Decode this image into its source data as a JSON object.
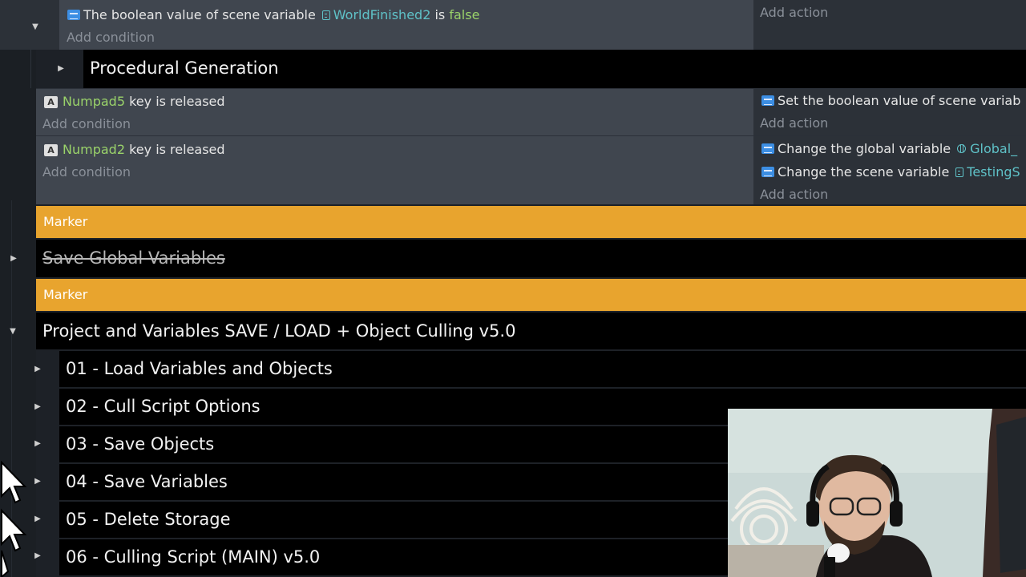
{
  "event_top": {
    "condition_prefix": "The boolean value of scene variable",
    "variable_name": "WorldFinished2",
    "condition_is": "is",
    "condition_value": "false",
    "add_condition": "Add condition",
    "add_action": "Add action"
  },
  "group_procedural": {
    "title": "Procedural Generation"
  },
  "event_numpad5": {
    "key": "Numpad5",
    "condition_text": "key is released",
    "add_condition": "Add condition",
    "action_text": "Set the boolean value of scene variab",
    "add_action": "Add action"
  },
  "event_numpad2": {
    "key": "Numpad2",
    "condition_text": "key is released",
    "add_condition": "Add condition",
    "action1_text": "Change the global variable",
    "action1_var": "Global_",
    "action2_text": "Change the scene variable",
    "action2_var": "TestingS",
    "add_action": "Add action"
  },
  "markers": [
    "Marker",
    "Marker"
  ],
  "group_save_global": {
    "title": "Save Global Variables"
  },
  "group_project": {
    "title": "Project and Variables SAVE / LOAD + Object Culling v5.0"
  },
  "subgroups": [
    "01 - Load Variables and Objects",
    "02 - Cull Script Options",
    "03 - Save Objects",
    "04 - Save Variables",
    "05 - Delete Storage",
    "06 - Culling Script (MAIN) v5.0"
  ],
  "key_icon_letter": "A",
  "icons": {
    "action_chip": "variable-action-icon",
    "key_chip": "keyboard-icon",
    "scene_var": "scene-variable-icon",
    "global_var": "global-variable-icon",
    "toggle_expanded": "chevron-down-icon",
    "toggle_collapsed": "chevron-right-icon"
  },
  "colors": {
    "marker": "#e8a42e",
    "group_bg": "#000000",
    "condition_bg": "#40464f",
    "highlight_green": "#9ad36a",
    "highlight_teal": "#5fc2c8"
  }
}
